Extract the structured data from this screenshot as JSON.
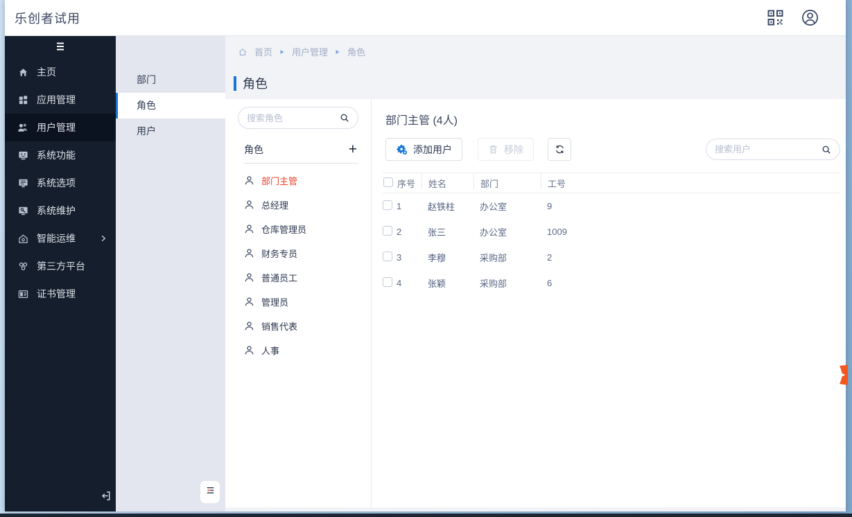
{
  "window": {
    "title": "乐创者试用"
  },
  "header": {
    "icons": [
      {
        "name": "qr-code-icon"
      },
      {
        "name": "user-circle-icon"
      }
    ]
  },
  "sidebar": {
    "toggle_icon": "menu-icon",
    "items": [
      {
        "id": "home",
        "label": "主页",
        "icon": "home-icon"
      },
      {
        "id": "apps",
        "label": "应用管理",
        "icon": "apps-icon"
      },
      {
        "id": "users",
        "label": "用户管理",
        "icon": "users-icon",
        "active": true
      },
      {
        "id": "sys-func",
        "label": "系统功能",
        "icon": "monitor-smile-icon"
      },
      {
        "id": "sys-option",
        "label": "系统选项",
        "icon": "monitor-doc-icon"
      },
      {
        "id": "sys-maint",
        "label": "系统维护",
        "icon": "monitor-wrench-icon"
      },
      {
        "id": "smart-ops",
        "label": "智能运维",
        "icon": "smart-ops-icon",
        "has_submenu": true
      },
      {
        "id": "third-party",
        "label": "第三方平台",
        "icon": "link-icon"
      },
      {
        "id": "certificate",
        "label": "证书管理",
        "icon": "certificate-icon"
      }
    ]
  },
  "subsidebar": {
    "items": [
      {
        "id": "department",
        "label": "部门"
      },
      {
        "id": "role",
        "label": "角色",
        "active": true
      },
      {
        "id": "user",
        "label": "用户"
      }
    ]
  },
  "breadcrumb": {
    "items": [
      "首页",
      "用户管理",
      "角色"
    ]
  },
  "page": {
    "title": "角色"
  },
  "role_panel": {
    "search_placeholder": "搜索角色",
    "list_title": "角色",
    "add_label": "+",
    "roles": [
      "部门主管",
      "总经理",
      "仓库管理员",
      "财务专员",
      "普通员工",
      "管理员",
      "销售代表",
      "人事"
    ],
    "selected_role": "部门主管"
  },
  "user_panel": {
    "title": "部门主管 (4人)",
    "add_button": "添加用户",
    "remove_button": "移除",
    "search_placeholder": "搜索用户",
    "table": {
      "columns": [
        "序号",
        "姓名",
        "部门",
        "工号"
      ],
      "rows": [
        {
          "no": "1",
          "name": "赵铁柱",
          "dept": "办公室",
          "id": "9"
        },
        {
          "no": "2",
          "name": "张三",
          "dept": "办公室",
          "id": "1009"
        },
        {
          "no": "3",
          "name": "李穆",
          "dept": "采购部",
          "id": "2"
        },
        {
          "no": "4",
          "name": "张颖",
          "dept": "采购部",
          "id": "6"
        }
      ]
    }
  },
  "colors": {
    "accent": "#1677d4",
    "sidebar_bg": "#141e2c",
    "sidebar_active_bg": "#0b1320",
    "subsidebar_bg": "#e3e6ee",
    "selected_role_text": "#e8452c",
    "main_bg": "#f1f3f7",
    "badge_orange": "#f4571f"
  }
}
